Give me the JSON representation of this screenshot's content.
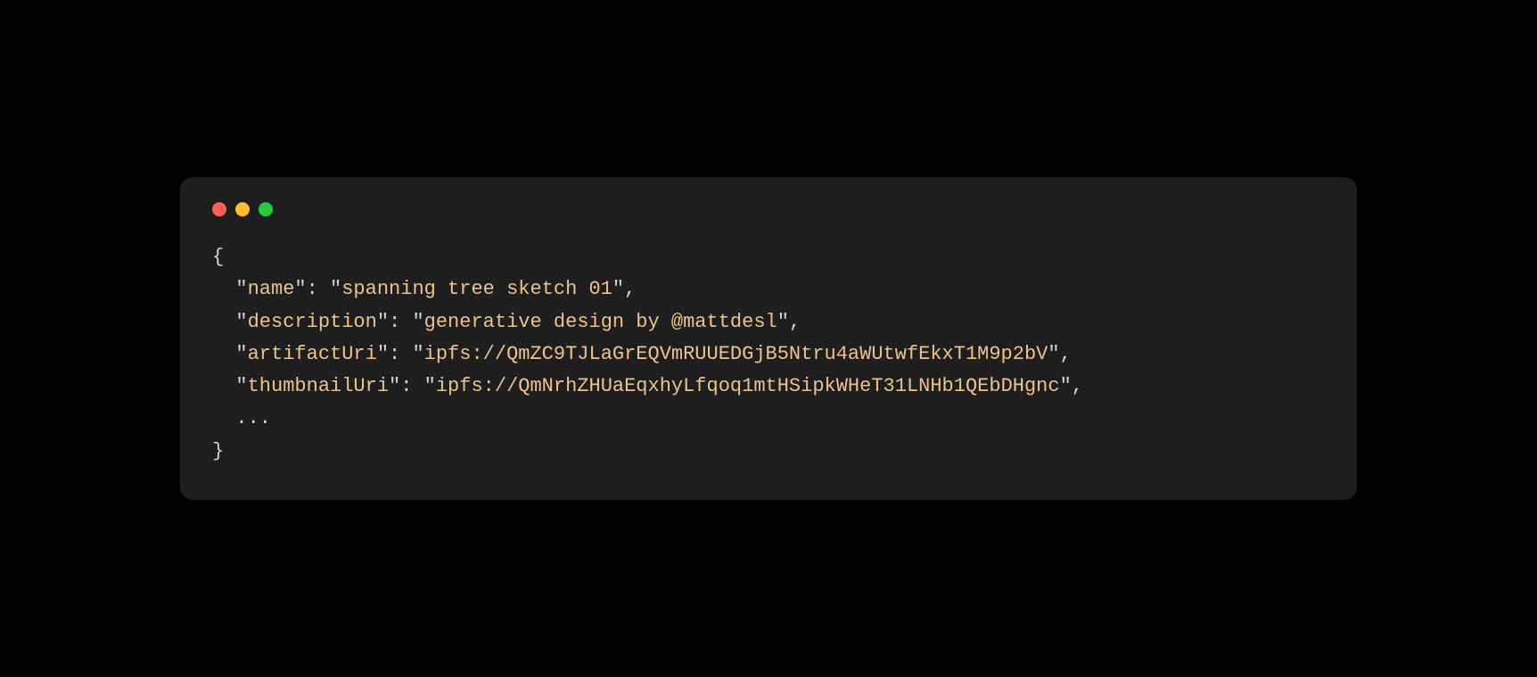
{
  "titlebar": {
    "close": "close",
    "minimize": "minimize",
    "maximize": "maximize"
  },
  "code": {
    "brace_open": "{",
    "brace_close": "}",
    "indent": "  ",
    "quote": "\"",
    "colon": ": ",
    "comma": ",",
    "ellipsis": "...",
    "entries": [
      {
        "key": "name",
        "value": "spanning tree sketch 01"
      },
      {
        "key": "description",
        "value": "generative design by @mattdesl"
      },
      {
        "key": "artifactUri",
        "value": "ipfs://QmZC9TJLaGrEQVmRUUEDGjB5Ntru4aWUtwfEkxT1M9p2bV"
      },
      {
        "key": "thumbnailUri",
        "value": "ipfs://QmNrhZHUaEqxhyLfqoq1mtHSipkWHeT31LNHb1QEbDHgnc"
      }
    ]
  }
}
